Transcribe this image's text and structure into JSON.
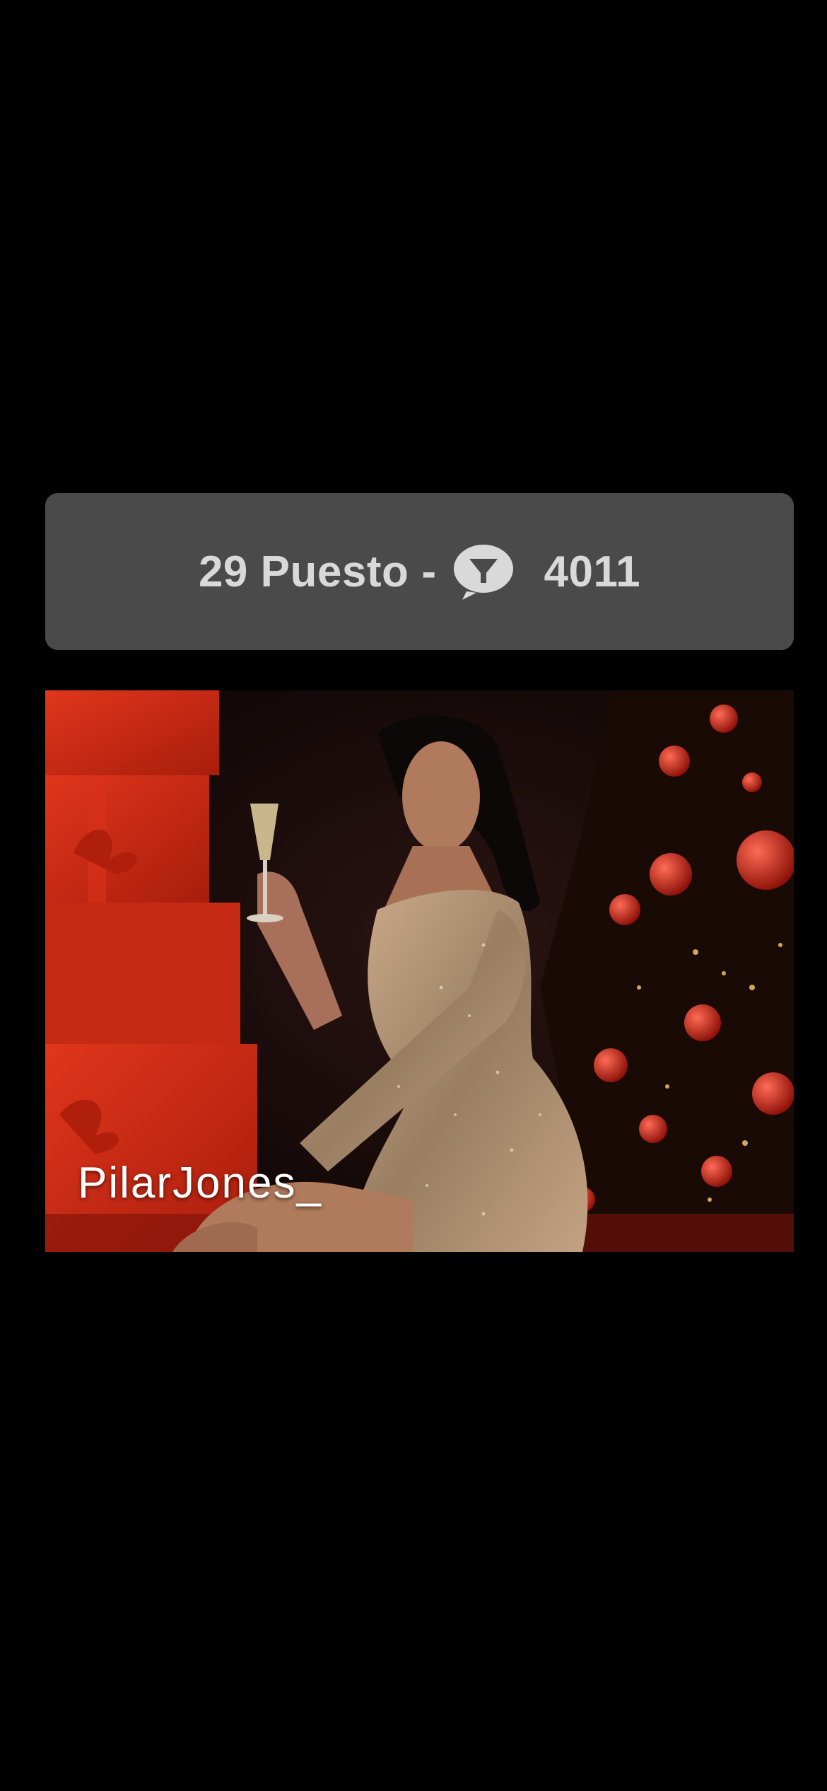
{
  "rank_bar": {
    "rank_text": "29 Puesto",
    "separator": "-",
    "token_icon": "chat-bubble-cup-icon",
    "token_count": "4011"
  },
  "profile_card": {
    "model_name": "PilarJones_"
  },
  "colors": {
    "background": "#000000",
    "rank_bar_bg": "#4a4a4a",
    "rank_bar_text": "#d9d9d9",
    "name_text": "#ffffff"
  }
}
